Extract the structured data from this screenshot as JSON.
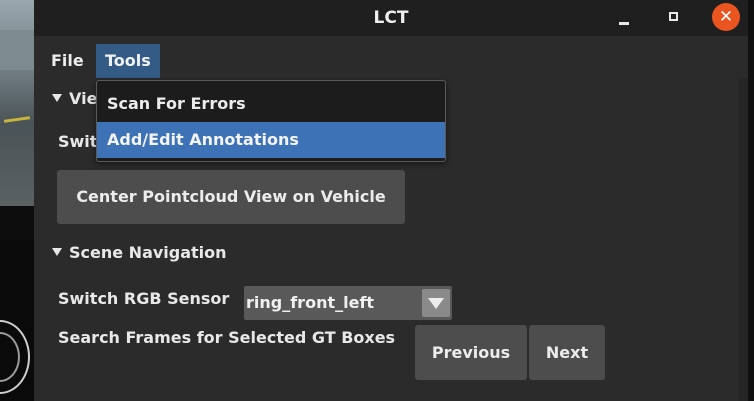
{
  "window": {
    "title": "LCT",
    "controls": {
      "minimize_icon": "minimize-icon",
      "maximize_icon": "maximize-icon",
      "close_icon": "close-icon",
      "close_glyph": "✕"
    }
  },
  "menubar": {
    "items": [
      {
        "label": "File"
      },
      {
        "label": "Tools",
        "active": true
      }
    ]
  },
  "tools_menu": {
    "items": [
      {
        "label": "Scan For Errors"
      },
      {
        "label": "Add/Edit Annotations",
        "highlighted": true
      }
    ]
  },
  "view_section": {
    "header_visible": "Vie",
    "switch_label_visible": "Swit",
    "center_button": "Center Pointcloud View on Vehicle"
  },
  "scene_navigation": {
    "header": "Scene Navigation",
    "switch_rgb_label": "Switch RGB Sensor",
    "rgb_sensor_value": "ring_front_left",
    "search_label": "Search Frames for Selected GT Boxes",
    "previous_button": "Previous",
    "next_button": "Next"
  },
  "colors": {
    "menu_active": "#345b86",
    "menu_highlight": "#3d73b6",
    "close_button": "#e9541f",
    "window_bg": "#2b2b2b",
    "button_bg": "#4d4d4d"
  }
}
